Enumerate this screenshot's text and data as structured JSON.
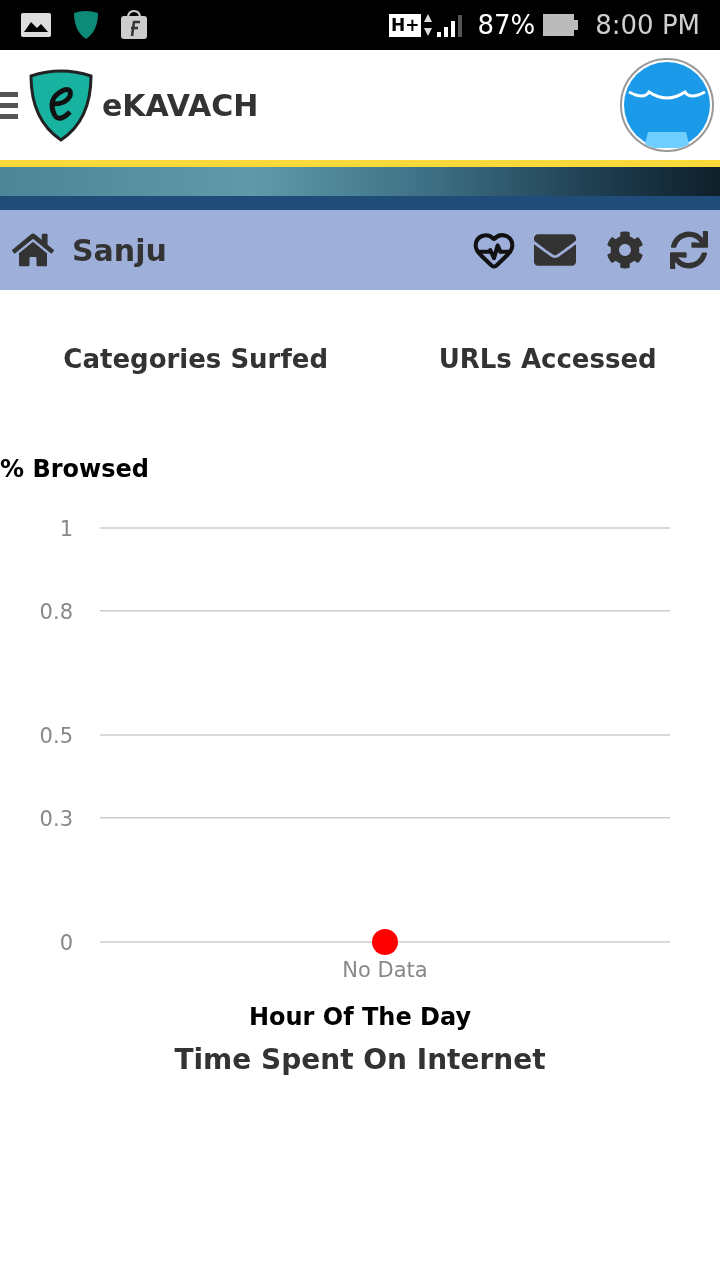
{
  "status_bar": {
    "network": "H+",
    "battery": "87%",
    "time": "8:00 PM"
  },
  "header": {
    "app_name": "eKAVACH"
  },
  "nav_bar": {
    "user": "Sanju"
  },
  "tabs": [
    {
      "label": "Categories Surfed"
    },
    {
      "label": "URLs Accessed"
    }
  ],
  "chart": {
    "chart_data": {
      "type": "scatter",
      "title": "Time Spent On Internet",
      "xlabel": "Hour Of The Day",
      "ylabel": "% Browsed",
      "categories": [
        "No Data"
      ],
      "series": [
        {
          "color": "#ff0000",
          "values": [
            0
          ]
        }
      ],
      "ylim": [
        0,
        1
      ],
      "grid": true,
      "yticks": [
        0,
        0.3,
        0.5,
        0.8,
        1
      ]
    }
  }
}
